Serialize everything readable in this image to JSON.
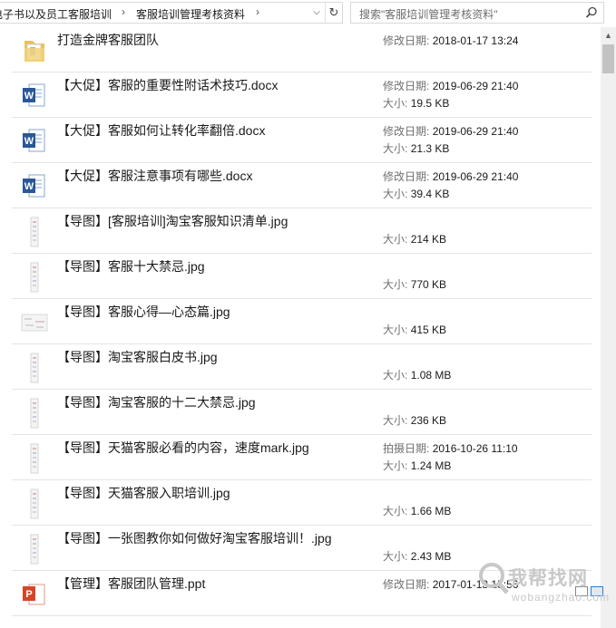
{
  "address_bar": {
    "breadcrumbs": [
      "电子书以及员工客服培训",
      "客服培训管理考核资料"
    ],
    "separator": "›",
    "dropdown_glyph": "⌵",
    "refresh_glyph": "↻"
  },
  "search": {
    "placeholder": "搜索\"客服培训管理考核资料\""
  },
  "labels": {
    "modified": "修改日期:",
    "size": "大小:",
    "taken": "拍摄日期:",
    "modified_partial": "修改日期: 2017-01-13 15:56"
  },
  "files": [
    {
      "name": "打造金牌客服团队",
      "icon": "folder-icon",
      "meta1_label": "修改日期:",
      "meta1_value": "2018-01-17 13:24",
      "meta2_label": "",
      "meta2_value": ""
    },
    {
      "name": "【大促】客服的重要性附话术技巧.docx",
      "icon": "word-doc-icon",
      "meta1_label": "修改日期:",
      "meta1_value": "2019-06-29 21:40",
      "meta2_label": "大小:",
      "meta2_value": "19.5 KB"
    },
    {
      "name": "【大促】客服如何让转化率翻倍.docx",
      "icon": "word-doc-icon",
      "meta1_label": "修改日期:",
      "meta1_value": "2019-06-29 21:40",
      "meta2_label": "大小:",
      "meta2_value": "21.3 KB"
    },
    {
      "name": "【大促】客服注意事项有哪些.docx",
      "icon": "word-doc-icon",
      "meta1_label": "修改日期:",
      "meta1_value": "2019-06-29 21:40",
      "meta2_label": "大小:",
      "meta2_value": "39.4 KB"
    },
    {
      "name": "【导图】[客服培训]淘宝客服知识清单.jpg",
      "icon": "image-thumbnail-icon",
      "meta1_label": "",
      "meta1_value": "",
      "meta2_label": "大小:",
      "meta2_value": "214 KB"
    },
    {
      "name": "【导图】客服十大禁忌.jpg",
      "icon": "image-thumbnail-icon",
      "meta1_label": "",
      "meta1_value": "",
      "meta2_label": "大小:",
      "meta2_value": "770 KB"
    },
    {
      "name": "【导图】客服心得—心态篇.jpg",
      "icon": "image-thumbnail-wide-icon",
      "meta1_label": "",
      "meta1_value": "",
      "meta2_label": "大小:",
      "meta2_value": "415 KB"
    },
    {
      "name": "【导图】淘宝客服白皮书.jpg",
      "icon": "image-thumbnail-icon",
      "meta1_label": "",
      "meta1_value": "",
      "meta2_label": "大小:",
      "meta2_value": "1.08 MB"
    },
    {
      "name": "【导图】淘宝客服的十二大禁忌.jpg",
      "icon": "image-thumbnail-icon",
      "meta1_label": "",
      "meta1_value": "",
      "meta2_label": "大小:",
      "meta2_value": "236 KB"
    },
    {
      "name": "【导图】天猫客服必看的内容，速度mark.jpg",
      "icon": "image-thumbnail-icon",
      "meta1_label": "拍摄日期:",
      "meta1_value": "2016-10-26 11:10",
      "meta2_label": "大小:",
      "meta2_value": "1.24 MB"
    },
    {
      "name": "【导图】天猫客服入职培训.jpg",
      "icon": "image-thumbnail-icon",
      "meta1_label": "",
      "meta1_value": "",
      "meta2_label": "大小:",
      "meta2_value": "1.66 MB"
    },
    {
      "name": "【导图】一张图教你如何做好淘宝客服培训！.jpg",
      "icon": "image-thumbnail-icon",
      "meta1_label": "",
      "meta1_value": "",
      "meta2_label": "大小:",
      "meta2_value": "2.43 MB"
    },
    {
      "name": "【管理】客服团队管理.ppt",
      "icon": "powerpoint-icon",
      "meta1_label": "修改日期:",
      "meta1_value": "2017-01-13 15:56",
      "meta2_label": "",
      "meta2_value": ""
    }
  ],
  "watermark": {
    "main": "我帮找网",
    "sub": "wobangzhao.com"
  },
  "colors": {
    "word_blue": "#2b5797",
    "ppt_orange": "#d24726",
    "folder_yellow": "#e8c15a",
    "divider": "#e4e4e4"
  }
}
